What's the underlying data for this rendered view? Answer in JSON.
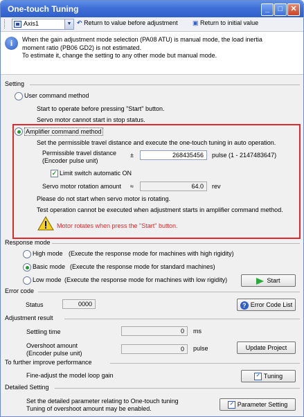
{
  "window": {
    "title": "One-touch Tuning",
    "minimize": "_",
    "maximize": "□",
    "close": "✕"
  },
  "toolbar": {
    "axis": "Axis1",
    "return_before": "Return to value before adjustment",
    "return_initial": "Return to initial value"
  },
  "info": {
    "lines": [
      "When the gain adjustment mode selection (PA08 ATU) is manual mode, the load inertia",
      "moment ratio (PB06 GD2) is not estimated.",
      "To estimate it, change the setting to any other mode but manual mode."
    ]
  },
  "setting": {
    "label": "Setting",
    "user_method": {
      "label": "User command method",
      "selected": false,
      "desc1": "Start to operate before pressing \"Start\" button.",
      "desc2": "Servo motor cannot start in stop status."
    },
    "amp_method": {
      "label": "Amplifier command method",
      "selected": true,
      "desc": "Set the permissible travel distance and execute the one-touch tuning in auto operation.",
      "travel_label1": "Permissible travel distance",
      "travel_label2": "(Encoder pulse unit)",
      "travel_sign": "±",
      "travel_value": "268435456",
      "travel_unit": "pulse (1 - 2147483647)",
      "limit_switch": "Limit switch automatic ON",
      "limit_checked": true,
      "rotation_label": "Servo motor rotation amount",
      "rotation_sign": "≈",
      "rotation_value": "64.0",
      "rotation_unit": "rev",
      "note1": "Please do not start when servo motor is rotating.",
      "note2": "Test operation cannot be executed when adjustment starts in amplifier command method.",
      "warning": "Motor rotates when press the \"Start\" button."
    }
  },
  "response": {
    "label": "Response mode",
    "options": [
      {
        "name": "High mode",
        "desc": "(Execute the response mode for machines with high rigidity)",
        "selected": false
      },
      {
        "name": "Basic mode",
        "desc": "(Execute the response mode for standard machines)",
        "selected": true
      },
      {
        "name": "Low mode",
        "desc": "(Execute the response mode for machines with low rigidity)",
        "selected": false
      }
    ],
    "start": "Start"
  },
  "error": {
    "label": "Error code",
    "status_label": "Status",
    "status_value": "0000",
    "list_button": "Error Code List"
  },
  "result": {
    "label": "Adjustment result",
    "settling_label": "Settling time",
    "settling_value": "0",
    "settling_unit": "ms",
    "overshoot_label1": "Overshoot amount",
    "overshoot_label2": "(Encoder pulse unit)",
    "overshoot_value": "0",
    "overshoot_unit": "pulse",
    "update_button": "Update Project"
  },
  "improve": {
    "label": "To further improve performance",
    "desc": "Fine-adjust the model loop gain",
    "button": "Tuning"
  },
  "detailed": {
    "label": "Detailed Setting",
    "desc1": "Set the detailed parameter relating to One-touch tuning",
    "desc2": "Tuning of overshoot amount may be enabled.",
    "button": "Parameter Setting"
  },
  "colors": {
    "accent_red": "#e3262b",
    "title_blue": "#3f6fd6",
    "selected_green": "#1f9b2e",
    "warning_text": "#e3262b"
  },
  "icons": [
    "info-icon",
    "warning-icon",
    "start-play-icon",
    "help-icon",
    "open-window-icon",
    "return-icon"
  ]
}
